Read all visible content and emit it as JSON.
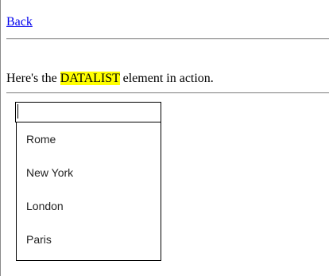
{
  "nav": {
    "back_label": "Back"
  },
  "intro": {
    "prefix": "Here's the ",
    "highlight": "DATALIST",
    "suffix": " element in action."
  },
  "input": {
    "value": ""
  },
  "datalist": {
    "options": [
      "Rome",
      "New York",
      "London",
      "Paris"
    ]
  },
  "colors": {
    "link": "#0000ee",
    "highlight": "#ffff00"
  }
}
